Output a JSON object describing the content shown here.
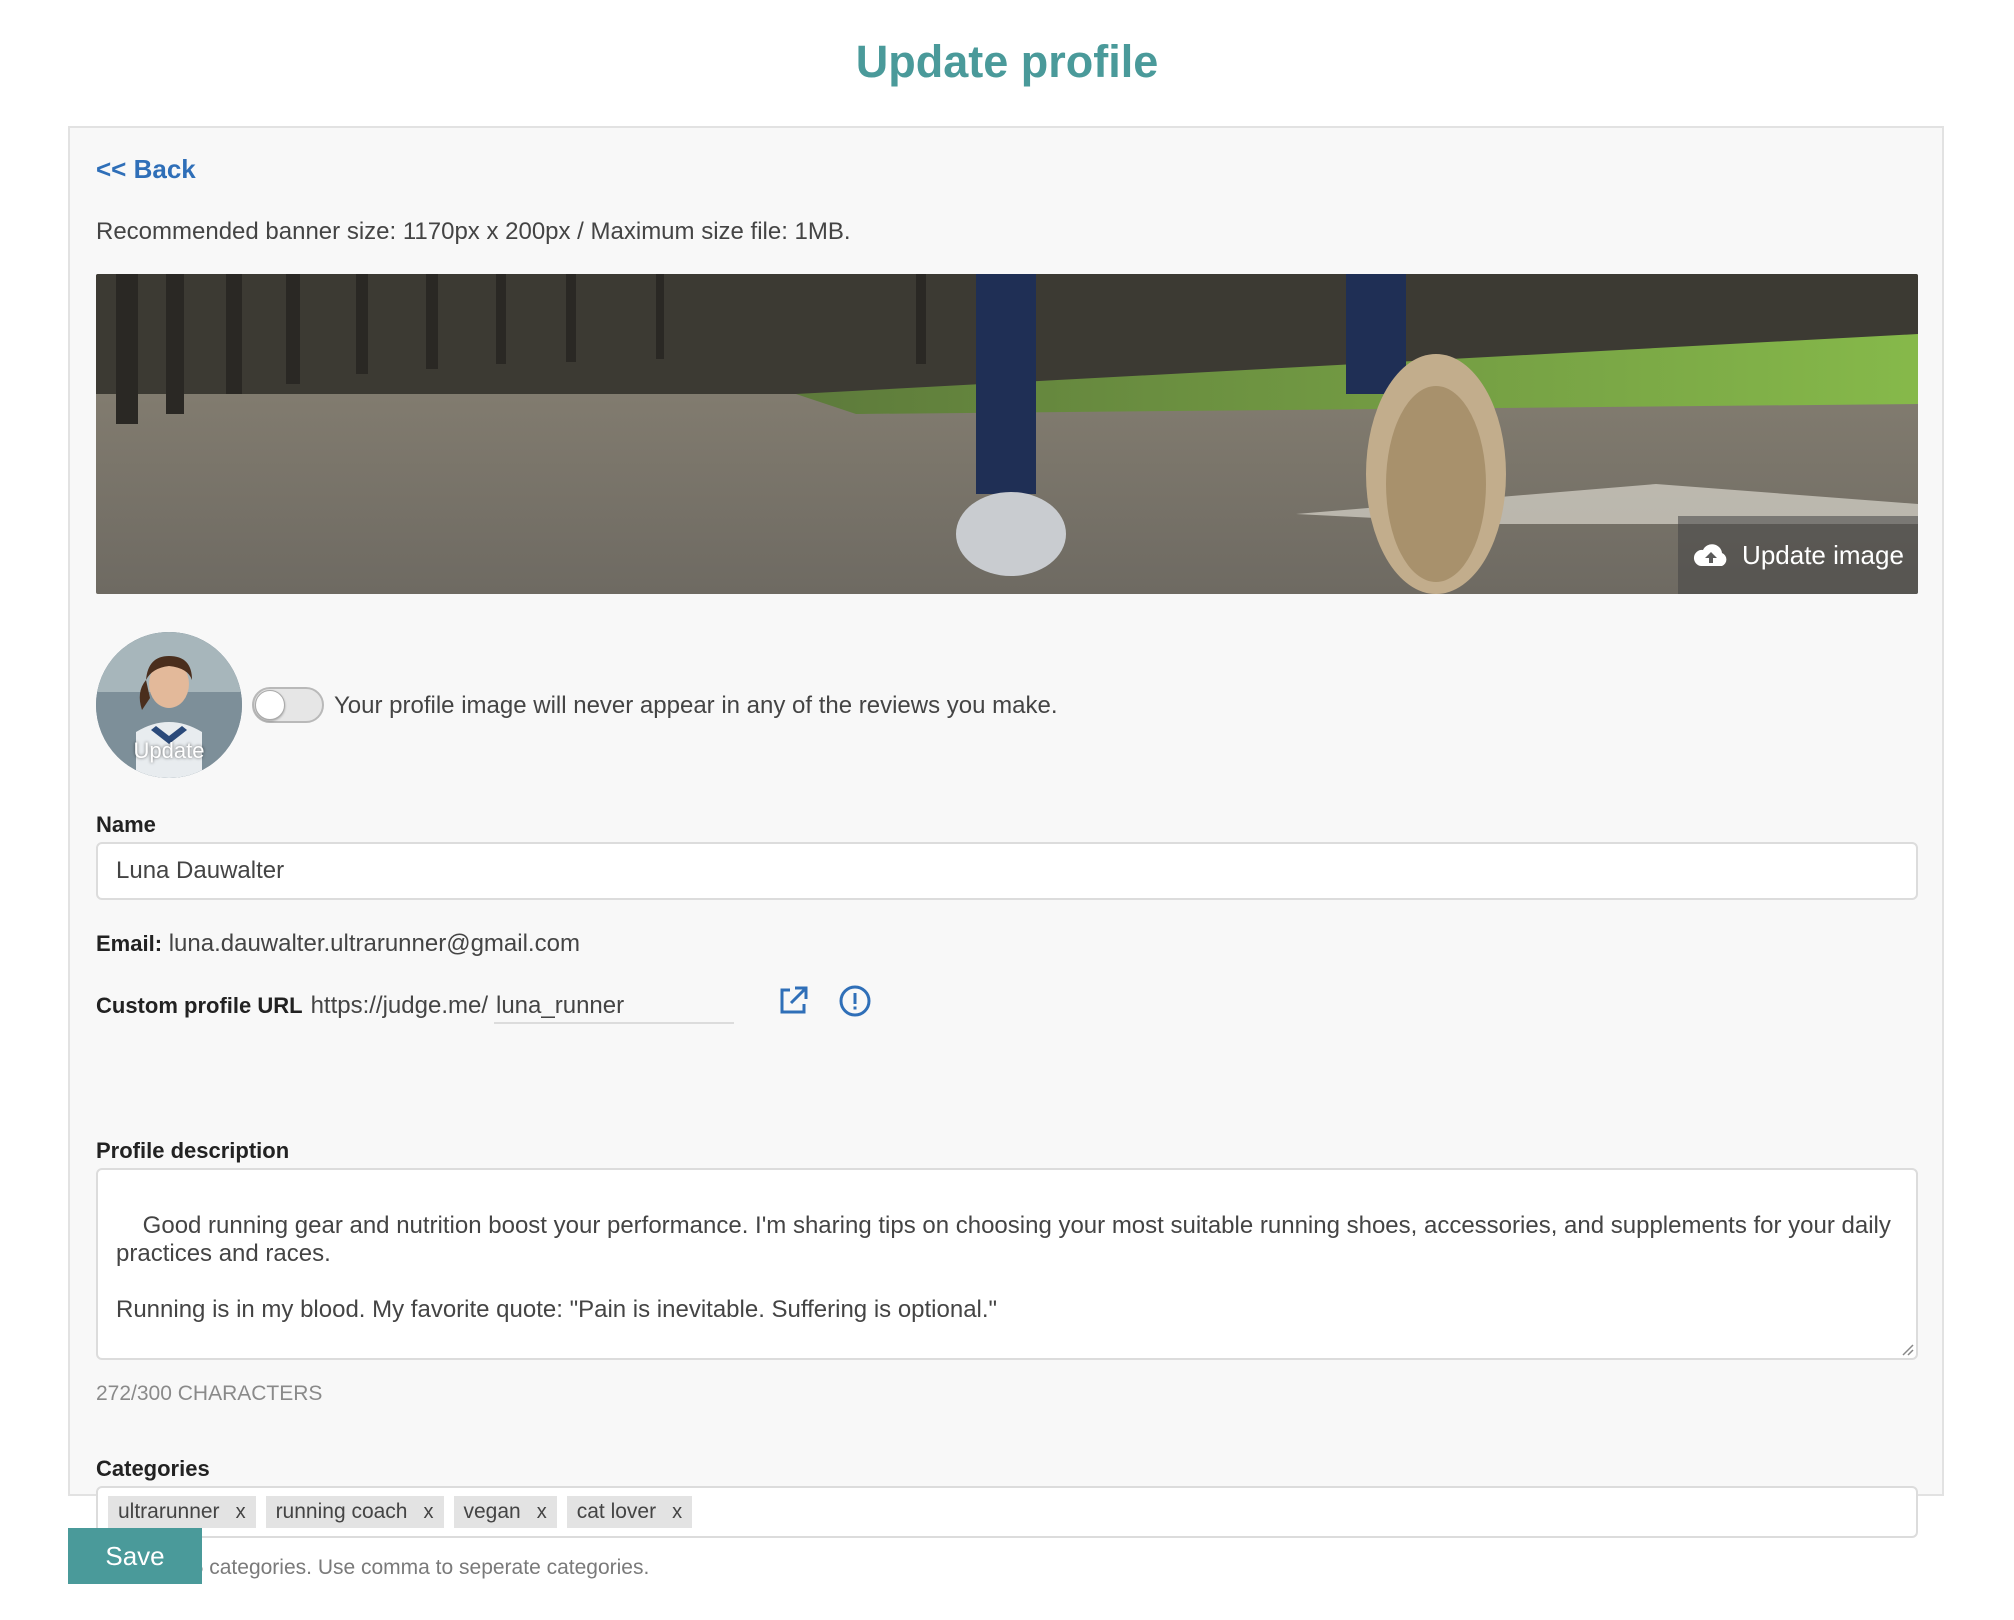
{
  "page": {
    "title": "Update profile"
  },
  "nav": {
    "back_label": "<< Back"
  },
  "banner": {
    "note": "Recommended banner size: 1170px x 200px / Maximum size file: 1MB.",
    "update_label": "Update image"
  },
  "avatar": {
    "update_label": "Update",
    "toggle_on": false,
    "toggle_text": "Your profile image will never appear in any of the reviews you make."
  },
  "form": {
    "name_label": "Name",
    "name_value": "Luna Dauwalter",
    "email_label": "Email:",
    "email_value": "luna.dauwalter.ultrarunner@gmail.com",
    "url_label": "Custom profile URL",
    "url_prefix": "https://judge.me/",
    "url_value": "luna_runner",
    "description_label": "Profile description",
    "description_value": "Good running gear and nutrition boost your performance. I'm sharing tips on choosing your most suitable running shoes, accessories, and supplements for your daily practices and races.\n\nRunning is in my blood. My favorite quote: \"Pain is inevitable. Suffering is optional.\"",
    "char_count": "272/300 CHARACTERS",
    "categories_label": "Categories",
    "categories": [
      {
        "label": "ultrarunner",
        "remove": "x"
      },
      {
        "label": "running coach",
        "remove": "x"
      },
      {
        "label": "vegan",
        "remove": "x"
      },
      {
        "label": "cat lover",
        "remove": "x"
      }
    ],
    "categories_help": "Add up to 5 categories. Use comma to seperate categories."
  },
  "actions": {
    "save_label": "Save"
  },
  "colors": {
    "accent": "#4a9a9a",
    "link": "#2f6fb8"
  }
}
